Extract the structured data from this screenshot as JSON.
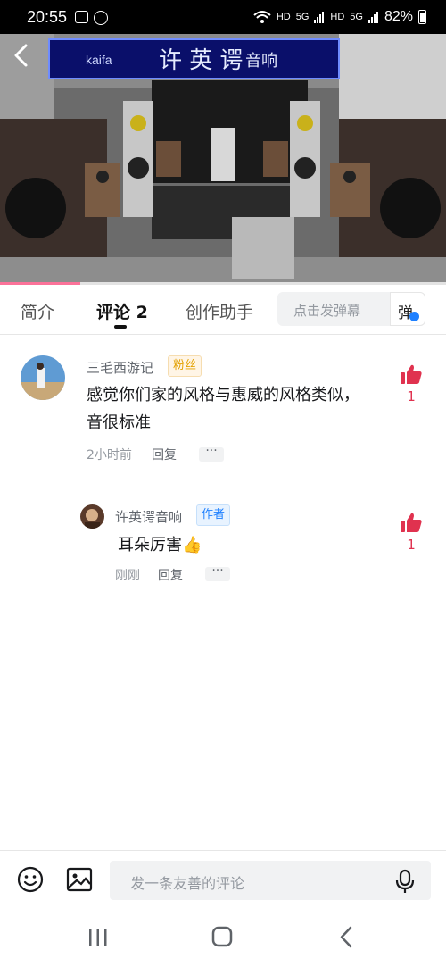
{
  "status_bar": {
    "time": "20:55",
    "net1": "HD",
    "net2": "5G",
    "net3": "HD",
    "net4": "5G",
    "battery": "82%"
  },
  "video": {
    "banner_brand": "kaifa",
    "banner_title": "许 英 谔",
    "banner_sub": "音响",
    "progress_fraction": 0.18
  },
  "tabs": {
    "intro": "简介",
    "comments": "评论 2",
    "creator": "创作助手",
    "danmaku_placeholder": "点击发弹幕",
    "danmaku_button": "弹"
  },
  "comments": [
    {
      "user": "三毛西游记",
      "badge": "粉丝",
      "text": "感觉你们家的风格与惠威的风格类似，音很标准",
      "time": "2小时前",
      "reply": "回复",
      "more": "···",
      "likes": "1"
    },
    {
      "user": "许英谔音响",
      "badge": "作者",
      "text": "耳朵厉害👍",
      "time": "刚刚",
      "reply": "回复",
      "more": "···",
      "likes": "1"
    }
  ],
  "bottom": {
    "placeholder": "发一条友善的评论"
  },
  "icons": {
    "back": "back-icon",
    "like": "thumbs-up-icon",
    "emoji": "emoji-icon",
    "image": "image-icon",
    "mic": "mic-icon"
  },
  "colors": {
    "accent": "#fb7299",
    "like": "#e0324f",
    "author_badge": "#1e80ff",
    "fans_badge": "#e3a100"
  }
}
